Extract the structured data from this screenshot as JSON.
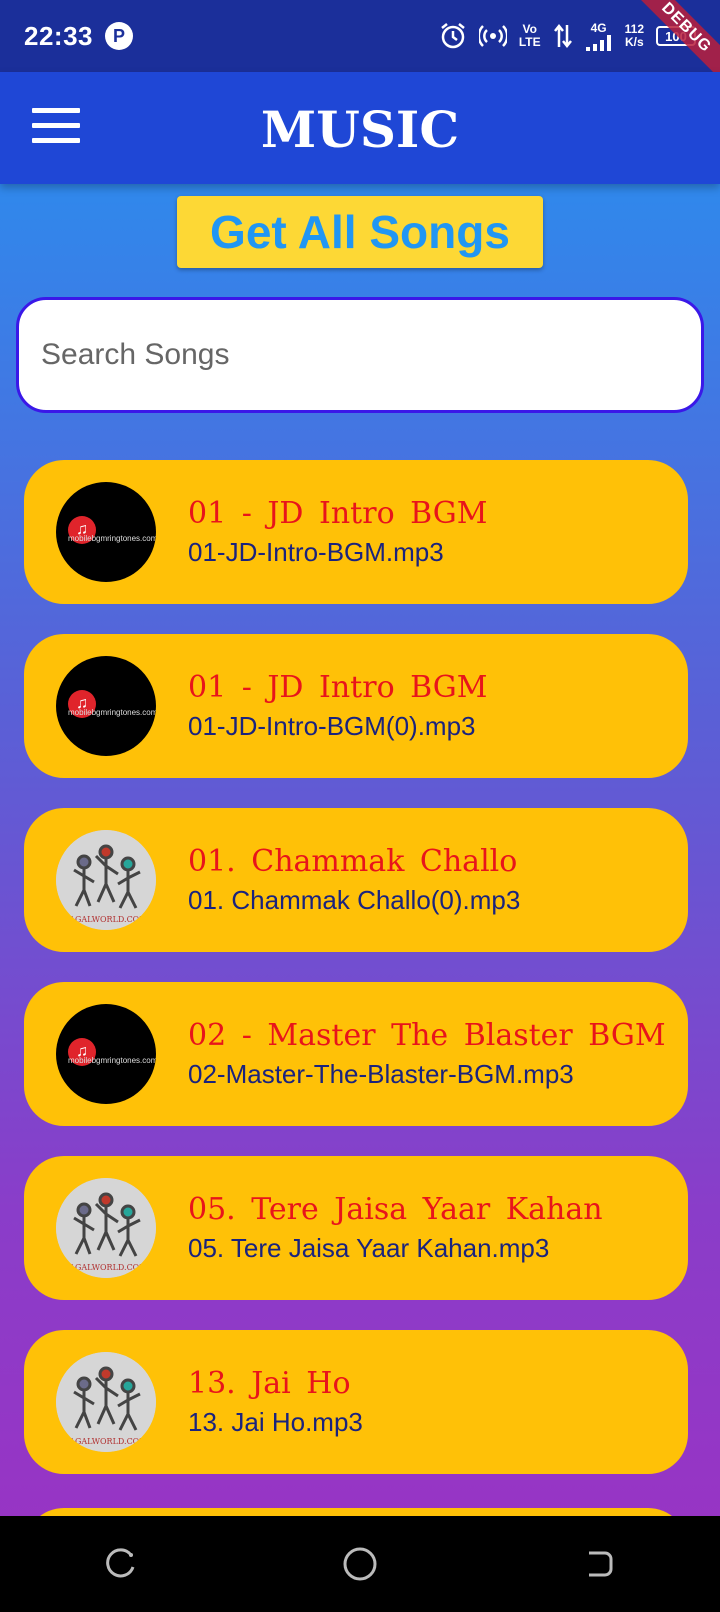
{
  "status_bar": {
    "time": "22:33",
    "network_top": "Vo",
    "network_bottom": "LTE",
    "network_type": "4G",
    "speed_value": "112",
    "speed_unit": "K/s",
    "battery": "100",
    "debug_banner": "DEBUG"
  },
  "app_bar": {
    "title": "MUSIC",
    "menu_icon": "hamburger-menu-icon"
  },
  "get_songs_label": "Get All Songs",
  "search": {
    "placeholder": "Search Songs",
    "value": ""
  },
  "songs": [
    {
      "title": "01 - JD Intro BGM",
      "file": "01-JD-Intro-BGM.mp3",
      "art": "black-music-note"
    },
    {
      "title": "01 - JD Intro BGM",
      "file": "01-JD-Intro-BGM(0).mp3",
      "art": "black-music-note"
    },
    {
      "title": "01. Chammak Challo",
      "file": "01. Chammak Challo(0).mp3",
      "art": "dancers"
    },
    {
      "title": "02 - Master The Blaster BGM",
      "file": "02-Master-The-Blaster-BGM.mp3",
      "art": "black-music-note"
    },
    {
      "title": "05. Tere Jaisa Yaar Kahan",
      "file": "05. Tere Jaisa Yaar Kahan.mp3",
      "art": "dancers"
    },
    {
      "title": "13. Jai Ho",
      "file": "13. Jai Ho.mp3",
      "art": "dancers"
    }
  ],
  "colors": {
    "app_bar": "#1f47d6",
    "card": "#ffc107",
    "title_text": "#e8141b",
    "file_text": "#1a237e",
    "button": "#fdd835"
  }
}
